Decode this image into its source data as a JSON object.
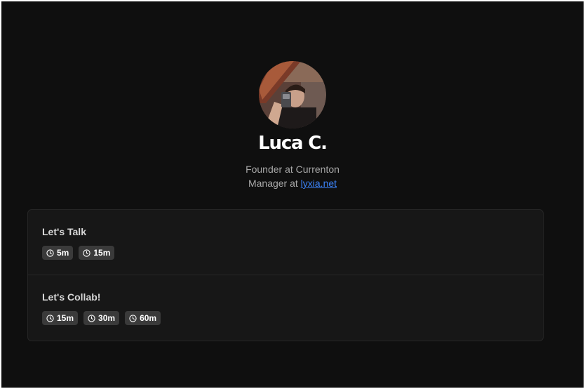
{
  "profile": {
    "name": "Luca C.",
    "bio_line1": "Founder at Currenton",
    "bio_line2_prefix": "Manager at ",
    "bio_link": "lyxia.net"
  },
  "events": [
    {
      "title": "Let's Talk",
      "durations": [
        "5m",
        "15m"
      ]
    },
    {
      "title": "Let's Collab!",
      "durations": [
        "15m",
        "30m",
        "60m"
      ]
    }
  ],
  "icons": {
    "duration": "clock-icon"
  },
  "colors": {
    "background": "#0f0f0f",
    "card": "#171717",
    "link": "#3b82f6",
    "badge": "#3a3a3a"
  }
}
